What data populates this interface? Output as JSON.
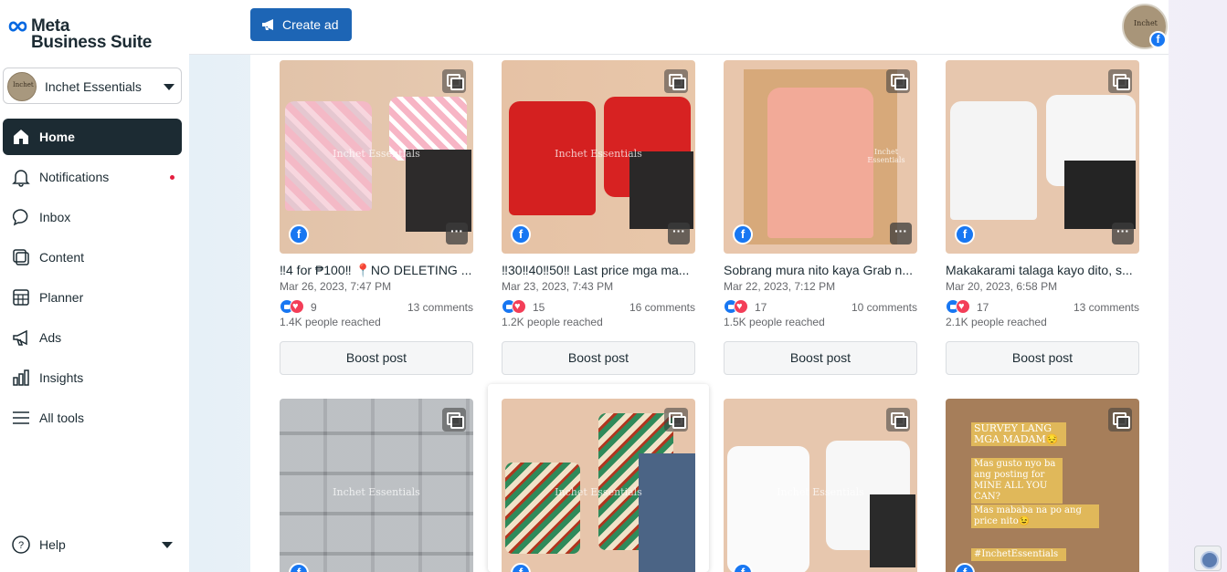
{
  "app": {
    "logo_line1": "Meta",
    "logo_line2": "Business Suite",
    "brand_color": "#1c2b33",
    "accent": "#1d65b5"
  },
  "account": {
    "name": "Inchet Essentials",
    "avatar_text": "Inchet"
  },
  "nav": [
    {
      "label": "Home",
      "icon": "home-icon",
      "active": true
    },
    {
      "label": "Notifications",
      "icon": "bell-icon",
      "badge": true
    },
    {
      "label": "Inbox",
      "icon": "chat-bubble-icon"
    },
    {
      "label": "Content",
      "icon": "content-icon"
    },
    {
      "label": "Planner",
      "icon": "calendar-icon"
    },
    {
      "label": "Ads",
      "icon": "megaphone-icon"
    },
    {
      "label": "Insights",
      "icon": "bar-chart-icon"
    },
    {
      "label": "All tools",
      "icon": "menu-icon"
    }
  ],
  "help": {
    "label": "Help"
  },
  "topbar": {
    "create_ad": "Create ad"
  },
  "profile": {
    "avatar_text": "Inchet",
    "fb_glyph": "f"
  },
  "posts": [
    {
      "title": "‼4 for ₱100‼ 📍NO DELETING ...",
      "date": "Mar 26, 2023, 7:47 PM",
      "reactions": "9",
      "comments": "13 comments",
      "reach": "1.4K people reached",
      "boost": "Boost post",
      "watermark": "Inchet Essentials"
    },
    {
      "title": "‼30‼40‼50‼ Last price mga ma...",
      "date": "Mar 23, 2023, 7:43 PM",
      "reactions": "15",
      "comments": "16 comments",
      "reach": "1.2K people reached",
      "boost": "Boost post",
      "watermark": "Inchet Essentials"
    },
    {
      "title": "Sobrang mura nito kaya Grab n...",
      "date": "Mar 22, 2023, 7:12 PM",
      "reactions": "17",
      "comments": "10 comments",
      "reach": "1.5K people reached",
      "boost": "Boost post",
      "watermark": "Inchet Essentials"
    },
    {
      "title": "Makakarami talaga kayo dito, s...",
      "date": "Mar 20, 2023, 6:58 PM",
      "reactions": "17",
      "comments": "13 comments",
      "reach": "2.1K people reached",
      "boost": "Boost post",
      "watermark": ""
    }
  ],
  "posts_row2": [
    {
      "watermark": "Inchet Essentials"
    },
    {
      "watermark": "Inchet Essentials"
    },
    {
      "watermark": "Inchet Essentials"
    },
    {
      "survey_lines": [
        "SURVEY LANG MGA MADAM😔",
        "Mas gusto nyo ba ang posting for MINE ALL YOU CAN?",
        "Mas mababa na po ang price nito😉",
        "#InchetEssentials"
      ]
    }
  ],
  "more_glyph": "···"
}
